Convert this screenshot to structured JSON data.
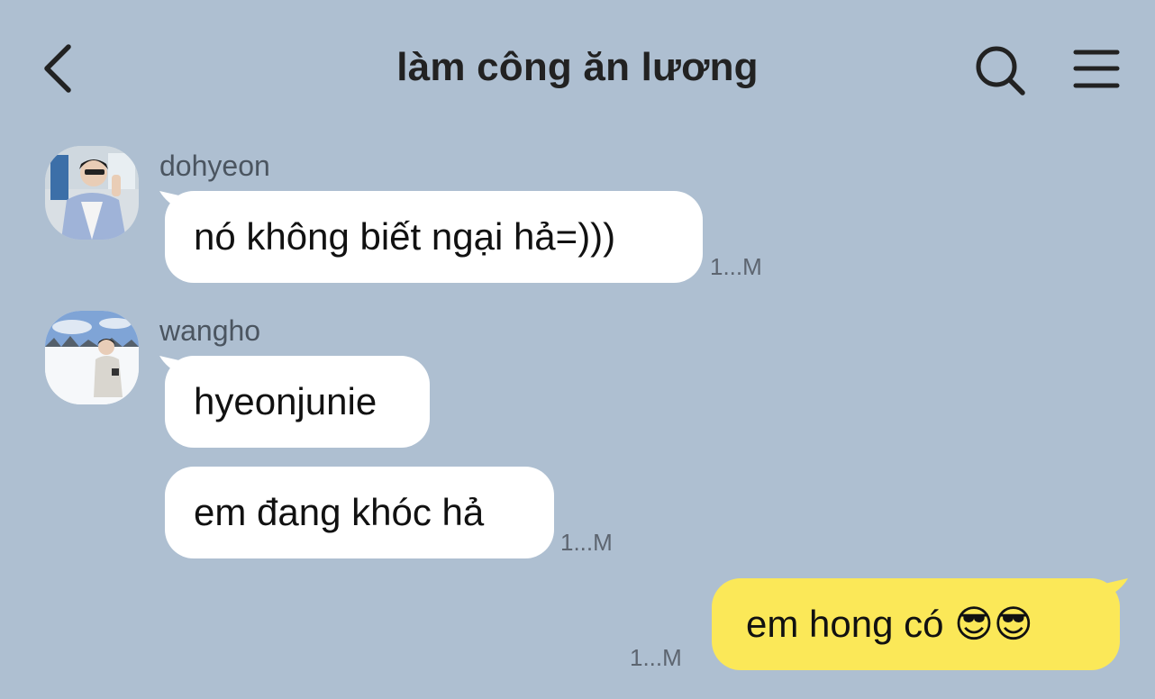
{
  "header": {
    "title": "làm công ăn lương"
  },
  "messages": [
    {
      "sender": "dohyeon",
      "text": "nó không biết ngại hả=)))",
      "time": "1...M"
    },
    {
      "sender": "wangho",
      "text": "hyeonjunie",
      "time": ""
    },
    {
      "sender": "wangho",
      "text": "em đang khóc hả",
      "time": "1...M"
    },
    {
      "sender": "me",
      "text": "em hong có 😎😎",
      "time": "1...M"
    }
  ],
  "colors": {
    "background": "#aebfd1",
    "incoming_bubble": "#ffffff",
    "outgoing_bubble": "#fbe858"
  }
}
